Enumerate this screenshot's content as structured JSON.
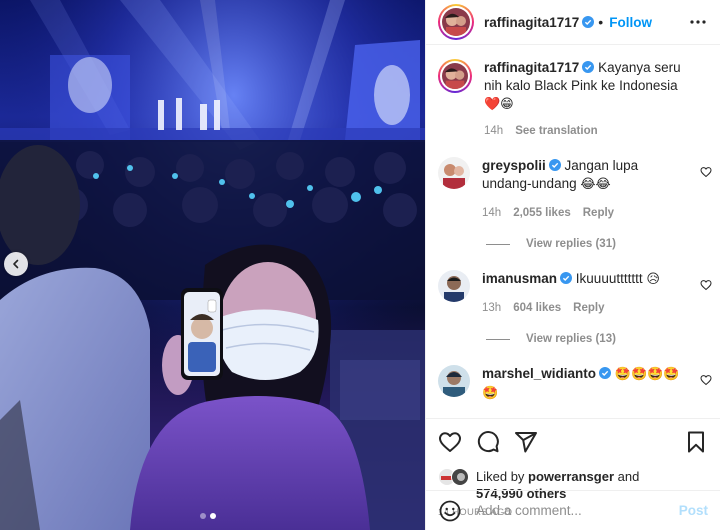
{
  "post": {
    "author": "raffinagita1717",
    "follow_label": "Follow",
    "separator": "•",
    "media": {
      "carousel_count": 2,
      "carousel_active": 2,
      "prev_icon": "chevron-left-icon"
    }
  },
  "caption": {
    "username": "raffinagita1717",
    "text": "Kayanya seru nih kalo Black Pink ke Indonesia",
    "emoji": "❤️😁",
    "time": "14h",
    "see_translation": "See translation"
  },
  "comments": [
    {
      "username": "greyspolii",
      "verified": true,
      "text": "Jangan lupa undang-undang",
      "emoji": "😂😂",
      "time": "14h",
      "likes": "2,055 likes",
      "reply": "Reply",
      "view_replies": "View replies (31)"
    },
    {
      "username": "imanusman",
      "verified": true,
      "text": "Ikuuuuttttttt",
      "emoji": "😥",
      "time": "13h",
      "likes": "604 likes",
      "reply": "Reply",
      "view_replies": "View replies (13)"
    },
    {
      "username": "marshel_widianto",
      "verified": true,
      "text": "",
      "emoji": "🤩🤩🤩🤩🤩"
    }
  ],
  "actions": {
    "icons": [
      "heart-icon",
      "comment-icon",
      "share-icon",
      "bookmark-icon"
    ]
  },
  "likes": {
    "prefix": "Liked by",
    "user": "powerransger",
    "and": "and",
    "count_text": "574,990 others"
  },
  "timestamp": "14 HOURS AGO",
  "add_comment": {
    "placeholder": "Add a comment...",
    "post_label": "Post"
  },
  "colors": {
    "accent": "#0095f6",
    "muted": "#8e8e8e",
    "post_disabled": "#b2dffc"
  }
}
